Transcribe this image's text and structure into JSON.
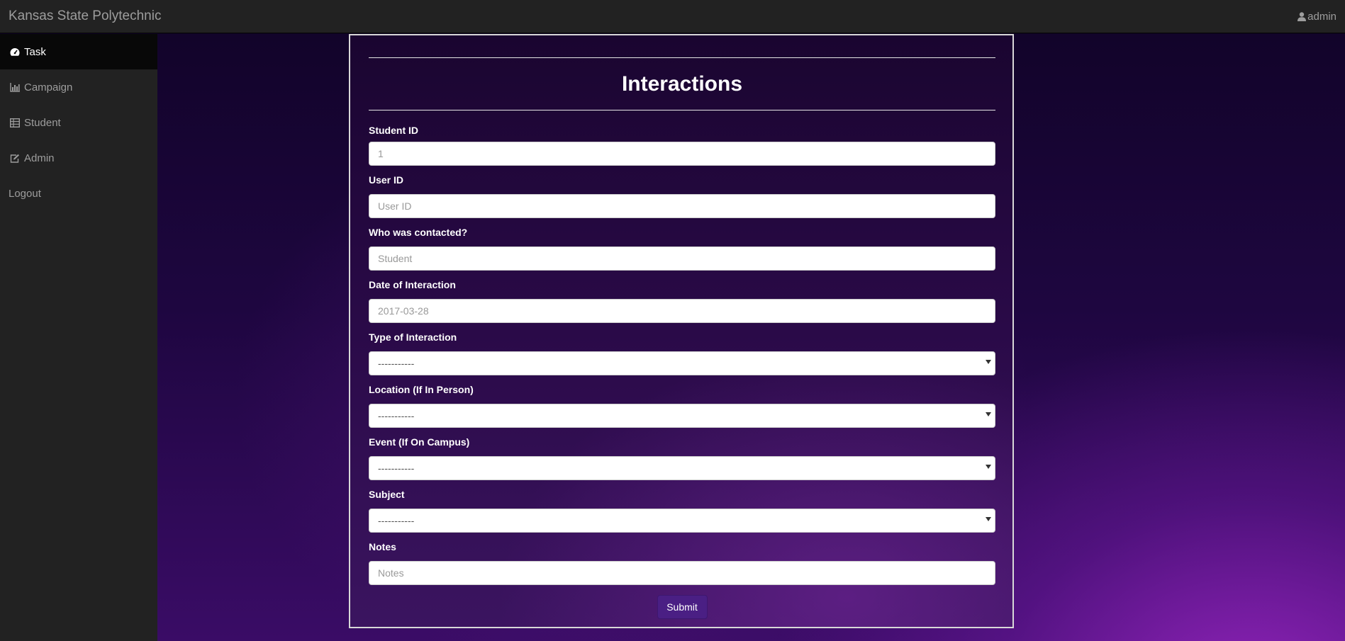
{
  "header": {
    "brand": "Kansas State Polytechnic",
    "user": "admin",
    "user_icon": "user-icon"
  },
  "sidebar": {
    "items": [
      {
        "label": "Task",
        "icon": "dashboard-icon",
        "active": true
      },
      {
        "label": "Campaign",
        "icon": "bar-chart-icon",
        "active": false
      },
      {
        "label": "Student",
        "icon": "table-icon",
        "active": false
      },
      {
        "label": "Admin",
        "icon": "edit-icon",
        "active": false
      },
      {
        "label": "Logout",
        "icon": "",
        "active": false
      }
    ]
  },
  "form": {
    "title": "Interactions",
    "fields": {
      "student_id": {
        "label": "Student ID",
        "placeholder": "1"
      },
      "user_id": {
        "label": "User ID",
        "placeholder": "User ID"
      },
      "contacted": {
        "label": "Who was contacted?",
        "placeholder": "Student"
      },
      "date": {
        "label": "Date of Interaction",
        "placeholder": "2017-03-28"
      },
      "type": {
        "label": "Type of Interaction",
        "value": "-----------"
      },
      "location": {
        "label": "Location (If In Person)",
        "value": "-----------"
      },
      "event": {
        "label": "Event (If On Campus)",
        "value": "-----------"
      },
      "subject": {
        "label": "Subject",
        "value": "-----------"
      },
      "notes": {
        "label": "Notes",
        "placeholder": "Notes"
      }
    },
    "submit_label": "Submit"
  },
  "colors": {
    "navbar": "#222222",
    "active_nav": "#080808",
    "submit_button": "#4a1f84",
    "panel_border": "#d8d8d8"
  }
}
